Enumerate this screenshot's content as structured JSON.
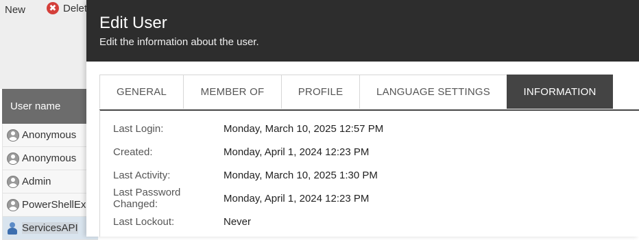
{
  "toolbar": {
    "new_label": "New",
    "delete_label": "Delet"
  },
  "grid": {
    "header": "User name",
    "rows": [
      {
        "name": "Anonymous",
        "icon": "user-avatar-icon"
      },
      {
        "name": "Anonymous",
        "icon": "user-avatar-icon"
      },
      {
        "name": "Admin",
        "icon": "user-avatar-icon"
      },
      {
        "name": "PowerShellEx",
        "icon": "user-avatar-icon"
      },
      {
        "name": "ServicesAPI",
        "icon": "service-user-icon",
        "selected": true
      }
    ]
  },
  "modal": {
    "title": "Edit User",
    "subtitle": "Edit the information about the user.",
    "tabs": [
      {
        "label": "GENERAL"
      },
      {
        "label": "MEMBER OF"
      },
      {
        "label": "PROFILE"
      },
      {
        "label": "LANGUAGE SETTINGS"
      },
      {
        "label": "INFORMATION",
        "active": true
      }
    ],
    "info": [
      {
        "label": "Last Login:",
        "value": "Monday, March 10, 2025 12:57 PM"
      },
      {
        "label": "Created:",
        "value": "Monday, April 1, 2024 12:23 PM"
      },
      {
        "label": "Last Activity:",
        "value": "Monday, March 10, 2025 1:30 PM"
      },
      {
        "label": "Last Password Changed:",
        "value": "Monday, April 1, 2024 12:23 PM"
      },
      {
        "label": "Last Lockout:",
        "value": "Never"
      }
    ]
  },
  "colors": {
    "header_bg": "#2d2d2d",
    "active_tab_bg": "#444444",
    "grid_header_bg": "#6c6c6c",
    "delete_icon": "#d43f3a"
  }
}
